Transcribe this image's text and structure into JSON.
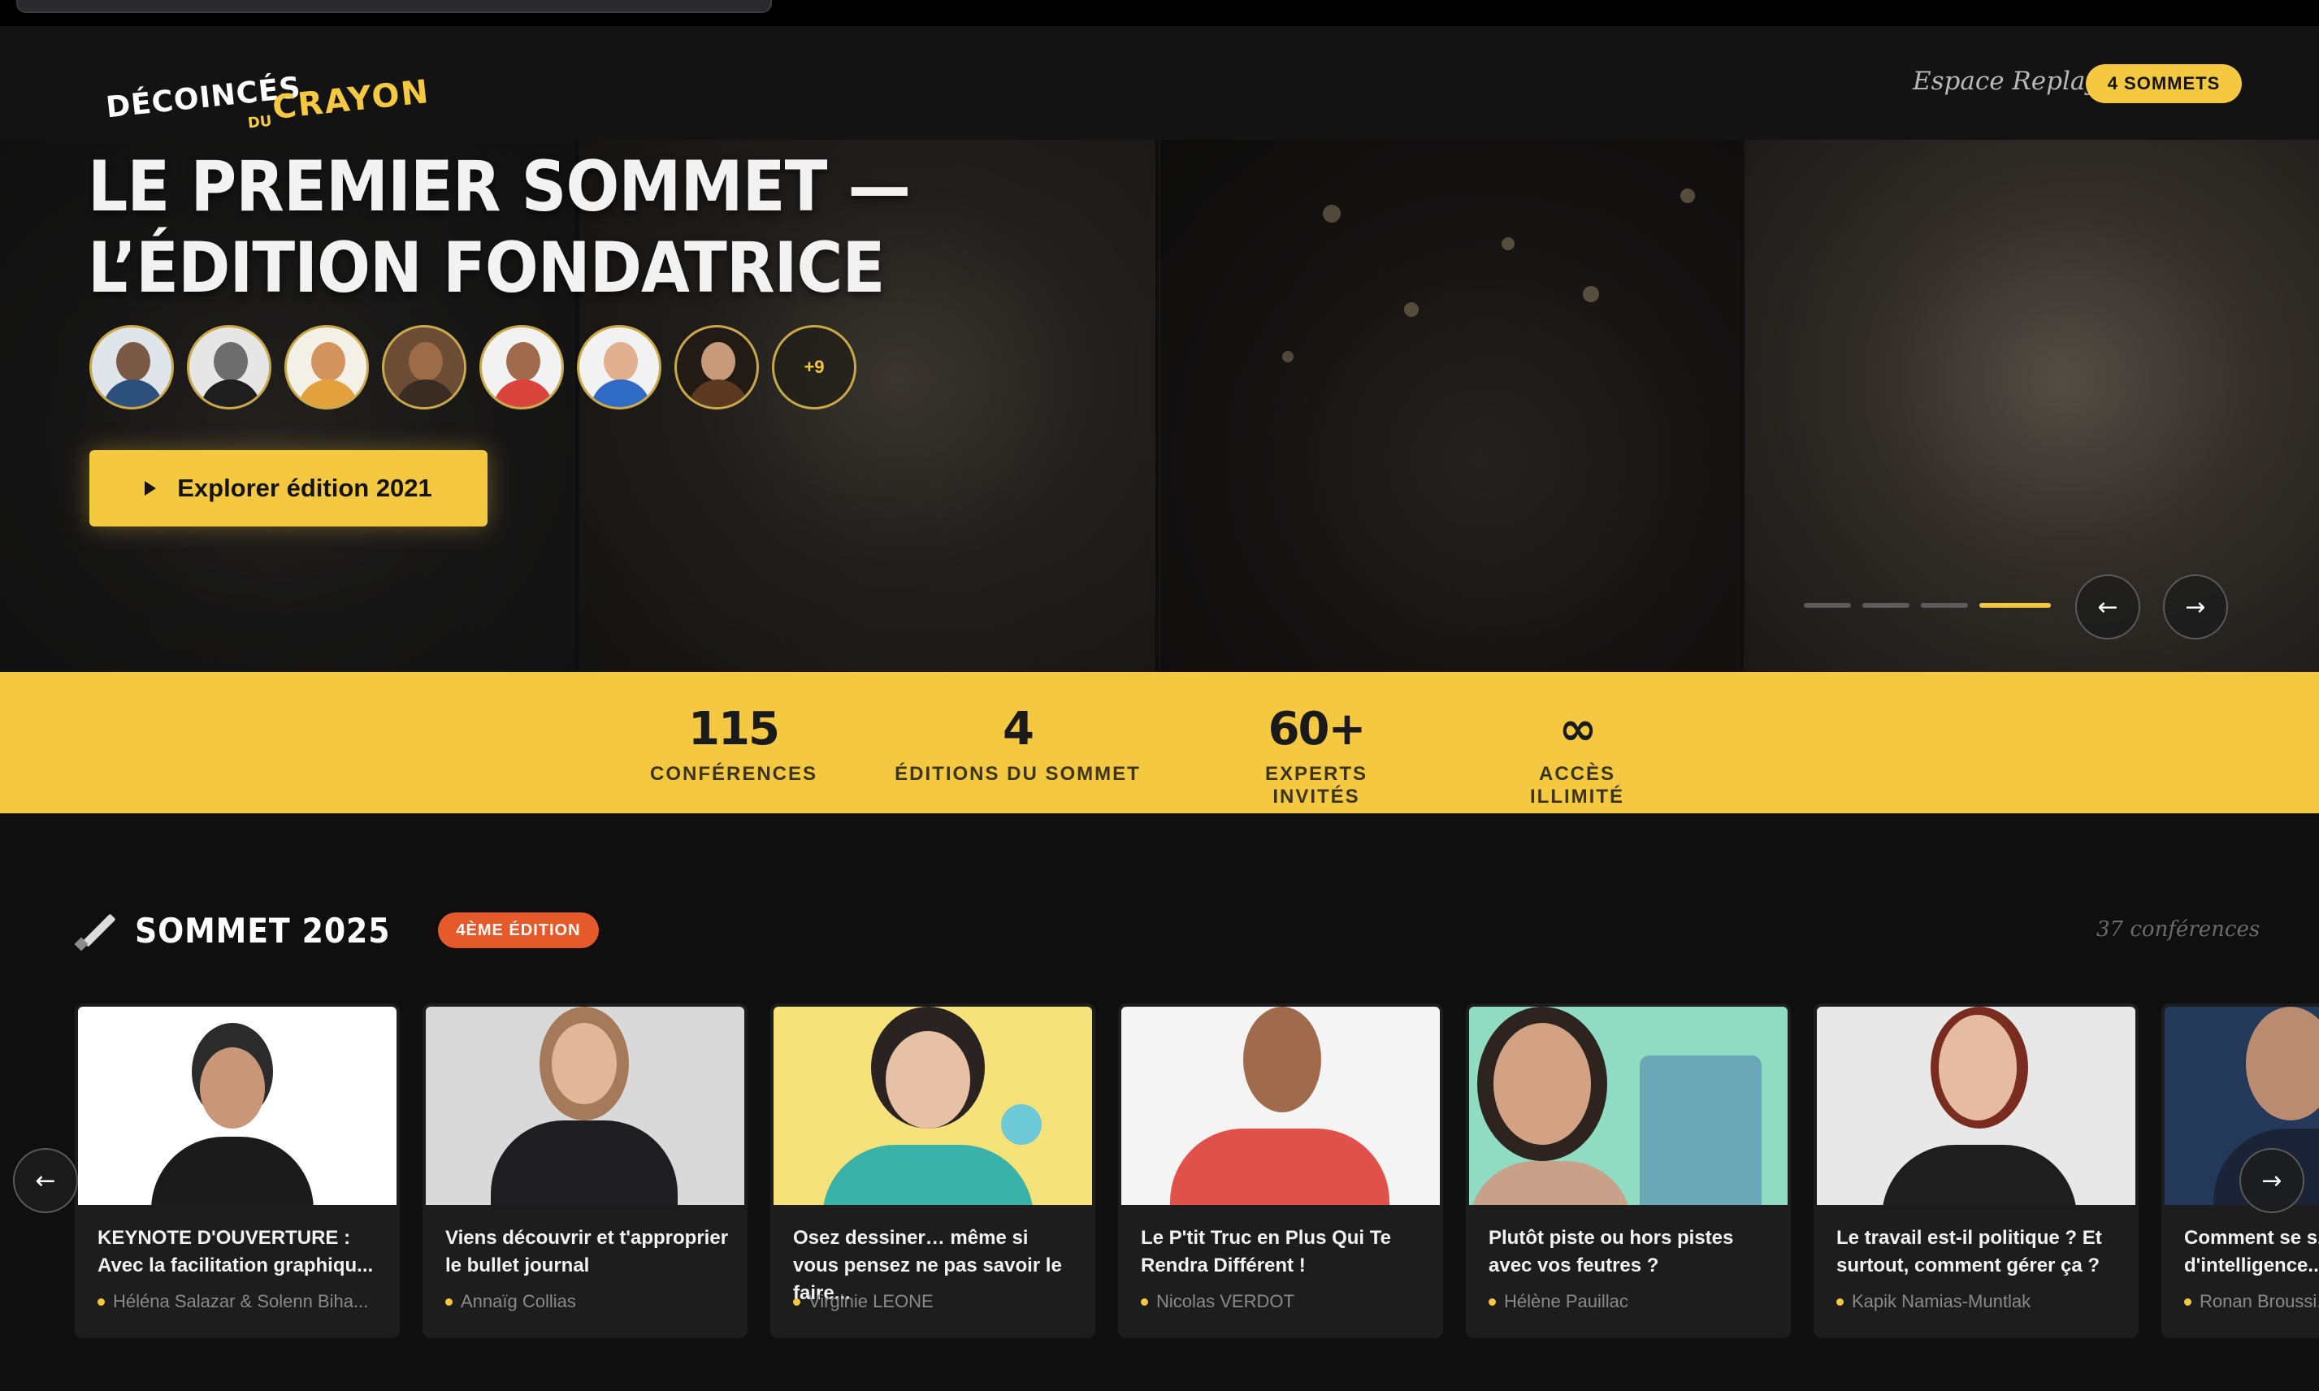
{
  "brand": {
    "line1": "DÉCOINCÉS",
    "line2": "DU",
    "line3": "CRAYON"
  },
  "nav": {
    "replays_link": "Espace Replays",
    "sommets_badge": "4 SOMMETS"
  },
  "hero": {
    "title": "LE PREMIER SOMMET — L’ÉDITION FONDATRICE",
    "more_speakers": "+9",
    "cta_label": "Explorer édition 2021",
    "slides_total": 4,
    "active_slide": 4,
    "prev_icon": "arrow-left-icon",
    "next_icon": "arrow-right-icon"
  },
  "stats": [
    {
      "value": "115",
      "label": "CONFÉRENCES"
    },
    {
      "value": "4",
      "label": "ÉDITIONS DU SOMMET"
    },
    {
      "value": "60+",
      "label": "EXPERTS INVITÉS"
    },
    {
      "value": "∞",
      "label": "ACCÈS ILLIMITÉ"
    }
  ],
  "section": {
    "title": "SOMMET 2025",
    "badge": "4ÈME ÉDITION",
    "count": "37 conférences",
    "cards": [
      {
        "title": "KEYNOTE D'OUVERTURE : Avec la facilitation graphiqu...",
        "author": "Héléna Salazar & Solenn Biha..."
      },
      {
        "title": "Viens découvrir et t'approprier le bullet journal",
        "author": "Annaïg Collias"
      },
      {
        "title": "Osez dessiner… même si vous pensez ne pas savoir le faire...",
        "author": "Virginie LEONE"
      },
      {
        "title": "Le P'tit Truc en Plus Qui Te Rendra Différent !",
        "author": "Nicolas VERDOT"
      },
      {
        "title": "Plutôt piste ou hors pistes avec vos feutres ?",
        "author": "Hélène Pauillac"
      },
      {
        "title": "Le travail est-il politique ? Et surtout, comment gérer ça ?",
        "author": "Kapik Namias-Muntlak"
      },
      {
        "title": "Comment se s... d'intelligence...",
        "author": "Ronan Broussi..."
      }
    ]
  },
  "colors": {
    "accent": "#f5c842",
    "badge": "#e55a2b",
    "background": "#0f0f10"
  }
}
